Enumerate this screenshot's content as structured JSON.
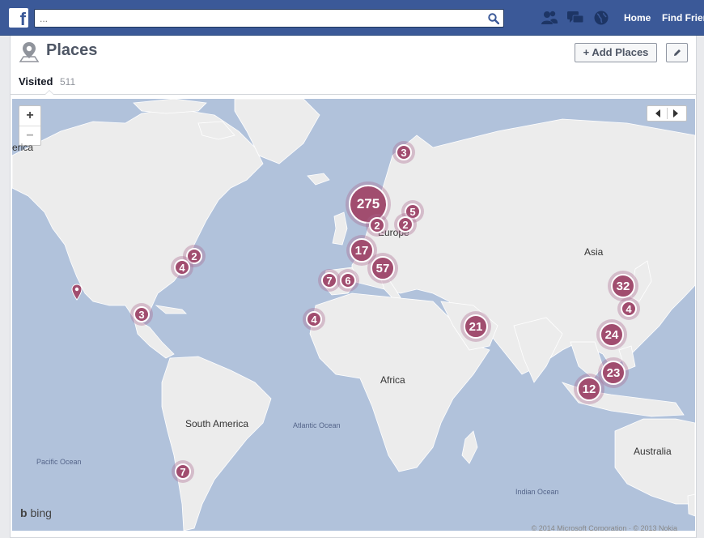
{
  "topbar": {
    "logo": "f",
    "search_placeholder": "...",
    "nav": {
      "home": "Home",
      "find_friends": "Find Friends"
    },
    "icons": [
      "friends-icon",
      "messages-icon",
      "globe-icon",
      "search-icon"
    ]
  },
  "header": {
    "title": "Places",
    "add_places_label": "+ Add Places",
    "edit_icon": "pencil-icon"
  },
  "tabs": {
    "visited_label": "Visited",
    "visited_count": "511"
  },
  "map": {
    "zoom_in": "+",
    "zoom_out": "−",
    "labels": {
      "america_partial": "erica",
      "europe": "Europe",
      "asia": "Asia",
      "africa": "Africa",
      "south_america": "South America",
      "australia": "Australia",
      "atlantic": "Atlantic Ocean",
      "pacific": "Pacific Ocean",
      "indian": "Indian Ocean"
    },
    "clusters": [
      "3",
      "275",
      "5",
      "2",
      "2",
      "2",
      "4",
      "17",
      "57",
      "7",
      "6",
      "3",
      "4",
      "21",
      "32",
      "4",
      "24",
      "23",
      "12",
      "7"
    ],
    "provider": "bing",
    "copyright": "© 2014 Microsoft Corporation · © 2013 Nokia"
  },
  "colors": {
    "brand": "#3b5998",
    "water": "#b1c2db",
    "land": "#ececec",
    "cluster": "#a14d6f"
  }
}
